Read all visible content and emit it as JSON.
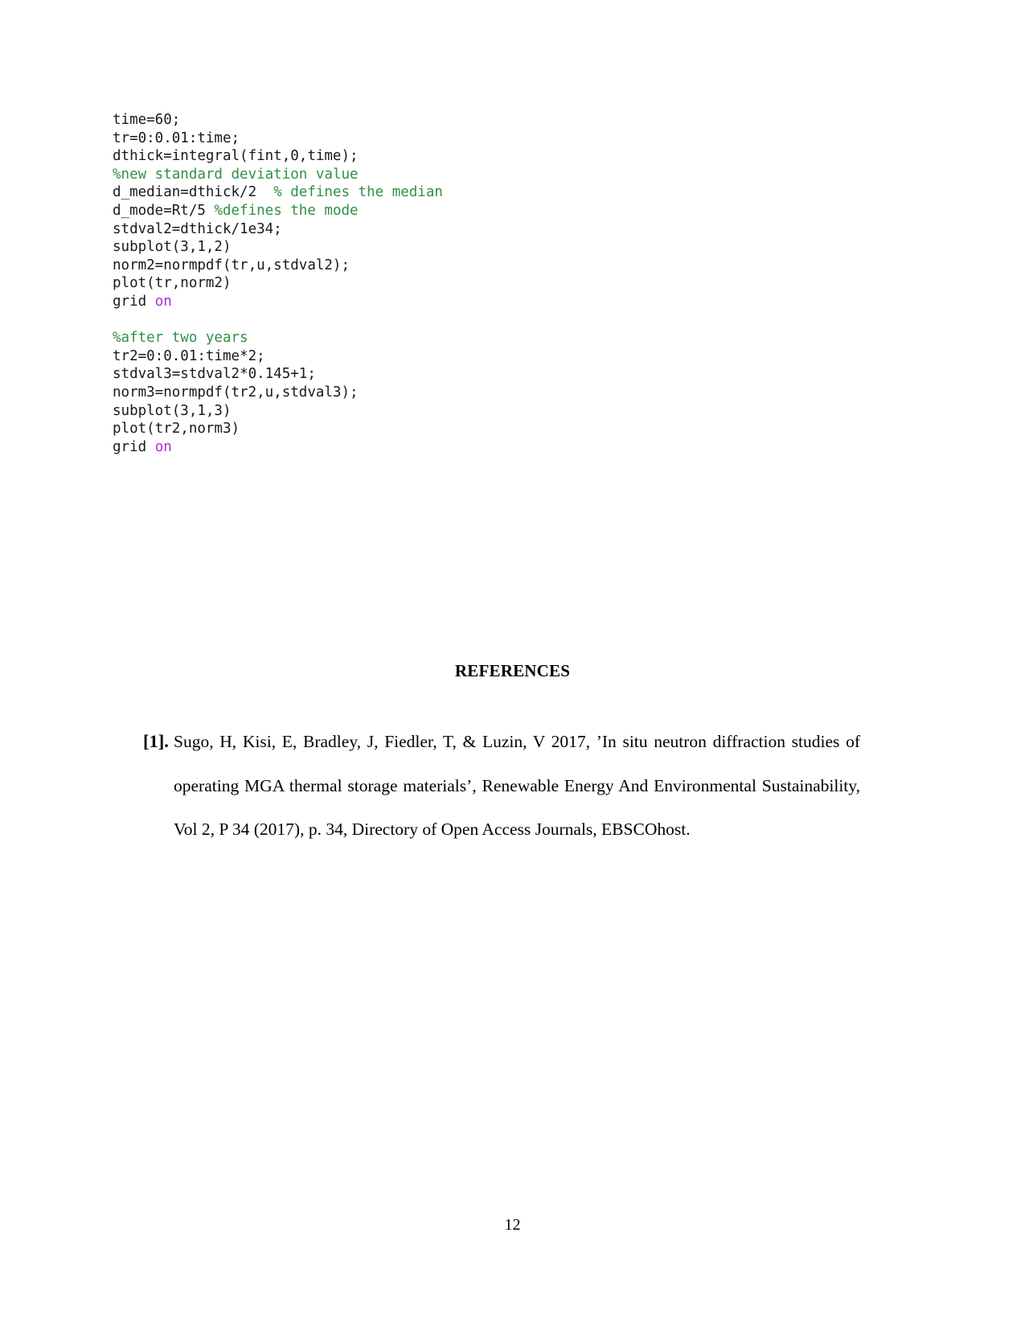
{
  "document": {
    "page_number": "12",
    "code_block": {
      "language_hint": "matlab",
      "lines": [
        [
          {
            "t": "plain",
            "s": "time=60;"
          }
        ],
        [
          {
            "t": "plain",
            "s": "tr=0:0.01:time;"
          }
        ],
        [
          {
            "t": "plain",
            "s": "dthick=integral(fint,0,time);"
          }
        ],
        [
          {
            "t": "comment",
            "s": "%new standard deviation value"
          }
        ],
        [
          {
            "t": "plain",
            "s": "d_median=dthick/2  "
          },
          {
            "t": "comment",
            "s": "% defines the median"
          }
        ],
        [
          {
            "t": "plain",
            "s": "d_mode=Rt/5 "
          },
          {
            "t": "comment",
            "s": "%defines the mode"
          }
        ],
        [
          {
            "t": "plain",
            "s": "stdval2=dthick/1e34;"
          }
        ],
        [
          {
            "t": "plain",
            "s": "subplot(3,1,2)"
          }
        ],
        [
          {
            "t": "plain",
            "s": "norm2=normpdf(tr,u,stdval2);"
          }
        ],
        [
          {
            "t": "plain",
            "s": "plot(tr,norm2)"
          }
        ],
        [
          {
            "t": "plain",
            "s": "grid "
          },
          {
            "t": "keyword",
            "s": "on"
          }
        ],
        [
          {
            "t": "plain",
            "s": ""
          }
        ],
        [
          {
            "t": "comment",
            "s": "%after two years"
          }
        ],
        [
          {
            "t": "plain",
            "s": "tr2=0:0.01:time*2;"
          }
        ],
        [
          {
            "t": "plain",
            "s": "stdval3=stdval2*0.145+1;"
          }
        ],
        [
          {
            "t": "plain",
            "s": "norm3=normpdf(tr2,u,stdval3);"
          }
        ],
        [
          {
            "t": "plain",
            "s": "subplot(3,1,3)"
          }
        ],
        [
          {
            "t": "plain",
            "s": "plot(tr2,norm3)"
          }
        ],
        [
          {
            "t": "plain",
            "s": "grid "
          },
          {
            "t": "keyword",
            "s": "on"
          }
        ]
      ],
      "colors": {
        "comment": "#2f9142",
        "keyword": "#ad29d6",
        "plain": "#1a1a1a"
      }
    },
    "references": {
      "heading": "REFERENCES",
      "items": [
        {
          "number": "[1].",
          "text": "Sugo, H, Kisi, E, Bradley, J, Fiedler, T, & Luzin, V 2017, ’In situ neutron diffraction studies of operating MGA thermal storage materials’, Renewable Energy And Environmental Sustainability, Vol 2, P 34 (2017), p. 34, Directory of Open Access Journals, EBSCOhost."
        }
      ]
    }
  }
}
